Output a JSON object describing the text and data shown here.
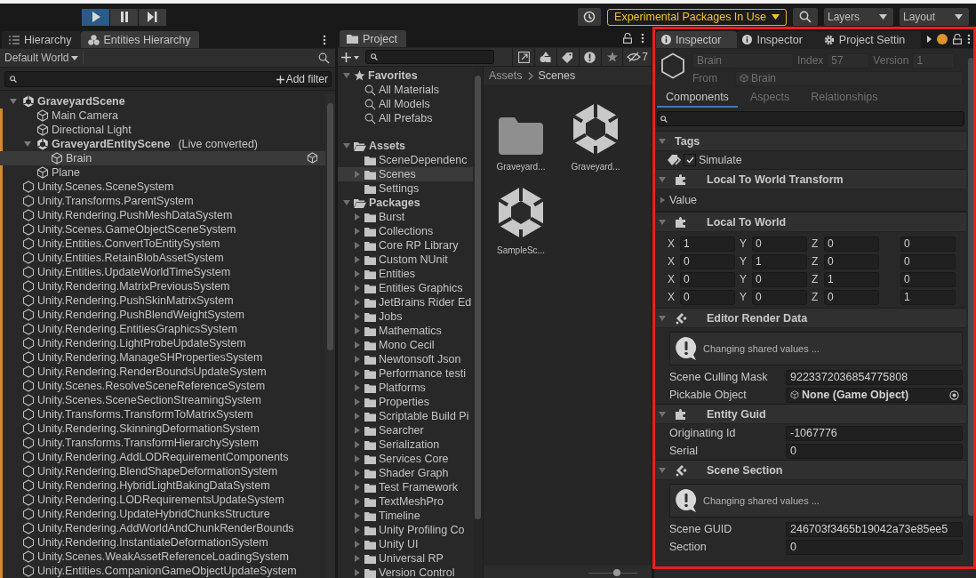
{
  "toolbar": {
    "play_buttons": [
      {
        "kind": "play",
        "active": true
      },
      {
        "kind": "pause",
        "active": false
      },
      {
        "kind": "step",
        "active": false
      }
    ],
    "experimental": "Experimental Packages In Use",
    "dropdowns": [
      "Layers",
      "Layout"
    ]
  },
  "hierarchy": {
    "tabs": [
      {
        "label": "Hierarchy",
        "kind": "list",
        "selected": false
      },
      {
        "label": "Entities Hierarchy",
        "kind": "entities",
        "selected": true
      }
    ],
    "world": "Default World",
    "add_filter": "Add filter",
    "items": [
      {
        "name": "GraveyardScene",
        "kind": "scene",
        "changed": false,
        "selected": false,
        "expanded": true,
        "children": [
          {
            "name": "Main Camera",
            "kind": "gameobject",
            "changed": true,
            "selected": false
          },
          {
            "name": "Directional Light",
            "kind": "gameobject",
            "changed": true,
            "selected": false
          },
          {
            "name": "GraveyardEntityScene",
            "note": "(Live converted)",
            "kind": "scene",
            "changed": true,
            "selected": false,
            "expanded": true,
            "children": [
              {
                "name": "Brain",
                "kind": "gameobject",
                "changed": false,
                "selected": true,
                "badge": true
              }
            ]
          },
          {
            "name": "Plane",
            "kind": "gameobject",
            "changed": true,
            "selected": false
          }
        ]
      },
      {
        "name": "Unity.Scenes.SceneSystem",
        "kind": "system",
        "changed": true,
        "selected": false
      },
      {
        "name": "Unity.Transforms.ParentSystem",
        "kind": "system",
        "changed": true,
        "selected": false
      },
      {
        "name": "Unity.Rendering.PushMeshDataSystem",
        "kind": "system",
        "changed": true,
        "selected": false
      },
      {
        "name": "Unity.Scenes.GameObjectSceneSystem",
        "kind": "system",
        "changed": true,
        "selected": false
      },
      {
        "name": "Unity.Entities.ConvertToEntitySystem",
        "kind": "system",
        "changed": true,
        "selected": false
      },
      {
        "name": "Unity.Entities.RetainBlobAssetSystem",
        "kind": "system",
        "changed": true,
        "selected": false
      },
      {
        "name": "Unity.Entities.UpdateWorldTimeSystem",
        "kind": "system",
        "changed": true,
        "selected": false
      },
      {
        "name": "Unity.Rendering.MatrixPreviousSystem",
        "kind": "system",
        "changed": true,
        "selected": false
      },
      {
        "name": "Unity.Rendering.PushSkinMatrixSystem",
        "kind": "system",
        "changed": true,
        "selected": false
      },
      {
        "name": "Unity.Rendering.PushBlendWeightSystem",
        "kind": "system",
        "changed": true,
        "selected": false
      },
      {
        "name": "Unity.Rendering.EntitiesGraphicsSystem",
        "kind": "system",
        "changed": true,
        "selected": false
      },
      {
        "name": "Unity.Rendering.LightProbeUpdateSystem",
        "kind": "system",
        "changed": true,
        "selected": false
      },
      {
        "name": "Unity.Rendering.ManageSHPropertiesSystem",
        "kind": "system",
        "changed": true,
        "selected": false
      },
      {
        "name": "Unity.Rendering.RenderBoundsUpdateSystem",
        "kind": "system",
        "changed": true,
        "selected": false
      },
      {
        "name": "Unity.Scenes.ResolveSceneReferenceSystem",
        "kind": "system",
        "changed": true,
        "selected": false
      },
      {
        "name": "Unity.Scenes.SceneSectionStreamingSystem",
        "kind": "system",
        "changed": true,
        "selected": false
      },
      {
        "name": "Unity.Transforms.TransformToMatrixSystem",
        "kind": "system",
        "changed": true,
        "selected": false
      },
      {
        "name": "Unity.Rendering.SkinningDeformationSystem",
        "kind": "system",
        "changed": true,
        "selected": false
      },
      {
        "name": "Unity.Transforms.TransformHierarchySystem",
        "kind": "system",
        "changed": true,
        "selected": false
      },
      {
        "name": "Unity.Rendering.AddLODRequirementComponents",
        "kind": "system",
        "changed": true,
        "selected": false
      },
      {
        "name": "Unity.Rendering.BlendShapeDeformationSystem",
        "kind": "system",
        "changed": true,
        "selected": false
      },
      {
        "name": "Unity.Rendering.HybridLightBakingDataSystem",
        "kind": "system",
        "changed": true,
        "selected": false
      },
      {
        "name": "Unity.Rendering.LODRequirementsUpdateSystem",
        "kind": "system",
        "changed": true,
        "selected": false
      },
      {
        "name": "Unity.Rendering.UpdateHybridChunksStructure",
        "kind": "system",
        "changed": true,
        "selected": false
      },
      {
        "name": "Unity.Rendering.AddWorldAndChunkRenderBounds",
        "kind": "system",
        "changed": true,
        "selected": false
      },
      {
        "name": "Unity.Rendering.InstantiateDeformationSystem",
        "kind": "system",
        "changed": true,
        "selected": false
      },
      {
        "name": "Unity.Scenes.WeakAssetReferenceLoadingSystem",
        "kind": "system",
        "changed": true,
        "selected": false
      },
      {
        "name": "Unity.Entities.CompanionGameObjectUpdateSystem",
        "kind": "system",
        "changed": true,
        "selected": false
      }
    ]
  },
  "project": {
    "tab": "Project",
    "zoom": {
      "level": 0.6
    },
    "hidden_count": "7",
    "breadcrumb": [
      "Assets",
      "Scenes"
    ],
    "tree": [
      {
        "name": "Favorites",
        "kind": "favorites",
        "selected": false,
        "expanded": true,
        "children": [
          {
            "name": "All Materials",
            "kind": "search",
            "selected": false
          },
          {
            "name": "All Models",
            "kind": "search",
            "selected": false
          },
          {
            "name": "All Prefabs",
            "kind": "search",
            "selected": false
          }
        ]
      },
      {
        "name": "Assets",
        "kind": "root",
        "selected": false,
        "expanded": true,
        "children": [
          {
            "name": "SceneDependenc",
            "kind": "folder",
            "selected": false
          },
          {
            "name": "Scenes",
            "kind": "folder",
            "selected": true,
            "expanded": false
          },
          {
            "name": "Settings",
            "kind": "folder",
            "selected": false
          }
        ]
      },
      {
        "name": "Packages",
        "kind": "root",
        "selected": false,
        "expanded": true,
        "children": [
          {
            "name": "Burst",
            "kind": "folder",
            "selected": false,
            "expanded": false
          },
          {
            "name": "Collections",
            "kind": "folder",
            "selected": false,
            "expanded": false
          },
          {
            "name": "Core RP Library",
            "kind": "folder",
            "selected": false,
            "expanded": false
          },
          {
            "name": "Custom NUnit",
            "kind": "folder",
            "selected": false,
            "expanded": false
          },
          {
            "name": "Entities",
            "kind": "folder",
            "selected": false,
            "expanded": false
          },
          {
            "name": "Entities Graphics",
            "kind": "folder",
            "selected": false,
            "expanded": false
          },
          {
            "name": "JetBrains Rider Ed",
            "kind": "folder",
            "selected": false,
            "expanded": false
          },
          {
            "name": "Jobs",
            "kind": "folder",
            "selected": false,
            "expanded": false
          },
          {
            "name": "Mathematics",
            "kind": "folder",
            "selected": false,
            "expanded": false
          },
          {
            "name": "Mono Cecil",
            "kind": "folder",
            "selected": false,
            "expanded": false
          },
          {
            "name": "Newtonsoft Json",
            "kind": "folder",
            "selected": false,
            "expanded": false
          },
          {
            "name": "Performance testi",
            "kind": "folder",
            "selected": false,
            "expanded": false
          },
          {
            "name": "Platforms",
            "kind": "folder",
            "selected": false,
            "expanded": false
          },
          {
            "name": "Properties",
            "kind": "folder",
            "selected": false,
            "expanded": false
          },
          {
            "name": "Scriptable Build Pi",
            "kind": "folder",
            "selected": false,
            "expanded": false
          },
          {
            "name": "Searcher",
            "kind": "folder",
            "selected": false,
            "expanded": false
          },
          {
            "name": "Serialization",
            "kind": "folder",
            "selected": false,
            "expanded": false
          },
          {
            "name": "Services Core",
            "kind": "folder",
            "selected": false,
            "expanded": false
          },
          {
            "name": "Shader Graph",
            "kind": "folder",
            "selected": false,
            "expanded": false
          },
          {
            "name": "Test Framework",
            "kind": "folder",
            "selected": false,
            "expanded": false
          },
          {
            "name": "TextMeshPro",
            "kind": "folder",
            "selected": false,
            "expanded": false
          },
          {
            "name": "Timeline",
            "kind": "folder",
            "selected": false,
            "expanded": false
          },
          {
            "name": "Unity Profiling Co",
            "kind": "folder",
            "selected": false,
            "expanded": false
          },
          {
            "name": "Unity UI",
            "kind": "folder",
            "selected": false,
            "expanded": false
          },
          {
            "name": "Universal RP",
            "kind": "folder",
            "selected": false,
            "expanded": false
          },
          {
            "name": "Version Control",
            "kind": "folder",
            "selected": false,
            "expanded": false
          }
        ]
      }
    ],
    "assets": [
      {
        "name": "Graveyard...",
        "kind": "folder"
      },
      {
        "name": "Graveyard...",
        "kind": "scene"
      },
      {
        "name": "SampleSc...",
        "kind": "scene"
      }
    ]
  },
  "inspector": {
    "tabs": [
      {
        "label": "Inspector",
        "kind": "info",
        "selected": true
      },
      {
        "label": "Inspector",
        "kind": "info",
        "selected": false
      },
      {
        "label": "Project Settin",
        "kind": "gear",
        "selected": false
      }
    ],
    "entity": {
      "name": "Brain",
      "index_label": "Index",
      "index": "57",
      "version_label": "Version",
      "version": "1",
      "from_label": "From",
      "from": "Brain"
    },
    "subtabs": [
      {
        "label": "Components",
        "selected": true
      },
      {
        "label": "Aspects",
        "selected": false
      },
      {
        "label": "Relationships",
        "selected": false
      }
    ],
    "sections": [
      {
        "title": "Tags",
        "kind": "tags",
        "expanded": true,
        "tags": [
          {
            "label": "Simulate",
            "checked": true
          }
        ]
      },
      {
        "title": "Local To World Transform",
        "kind": "component",
        "expanded": true,
        "foldouts": [
          {
            "label": "Value",
            "expanded": false
          }
        ]
      },
      {
        "title": "Local To World",
        "kind": "component",
        "expanded": true,
        "matrix": [
          {
            "cells": [
              {
                "axis": "X",
                "value": "1"
              },
              {
                "axis": "Y",
                "value": "0"
              },
              {
                "axis": "Z",
                "value": "0"
              },
              {
                "value": "0"
              }
            ]
          },
          {
            "cells": [
              {
                "axis": "X",
                "value": "0"
              },
              {
                "axis": "Y",
                "value": "1"
              },
              {
                "axis": "Z",
                "value": "0"
              },
              {
                "value": "0"
              }
            ]
          },
          {
            "cells": [
              {
                "axis": "X",
                "value": "0"
              },
              {
                "axis": "Y",
                "value": "0"
              },
              {
                "axis": "Z",
                "value": "1"
              },
              {
                "value": "0"
              }
            ]
          },
          {
            "cells": [
              {
                "axis": "X",
                "value": "0"
              },
              {
                "axis": "Y",
                "value": "0"
              },
              {
                "axis": "Z",
                "value": "0"
              },
              {
                "value": "1"
              }
            ]
          }
        ]
      },
      {
        "title": "Editor Render Data",
        "kind": "shared",
        "expanded": true,
        "help": "Changing shared values ...",
        "fields": [
          {
            "label": "Scene Culling Mask",
            "value": "9223372036854775808",
            "kind": "text"
          },
          {
            "label": "Pickable Object",
            "value": "None (Game Object)",
            "kind": "object"
          }
        ]
      },
      {
        "title": "Entity Guid",
        "kind": "component",
        "expanded": true,
        "fields": [
          {
            "label": "Originating Id",
            "value": "-1067776",
            "kind": "text"
          },
          {
            "label": "Serial",
            "value": "0",
            "kind": "text"
          }
        ]
      },
      {
        "title": "Scene Section",
        "kind": "shared",
        "expanded": true,
        "help": "Changing shared values ...",
        "fields": [
          {
            "label": "Scene GUID",
            "value": "246703f3465b19042a73e85ee5",
            "kind": "text"
          },
          {
            "label": "Section",
            "value": "0",
            "kind": "text"
          }
        ]
      }
    ]
  }
}
